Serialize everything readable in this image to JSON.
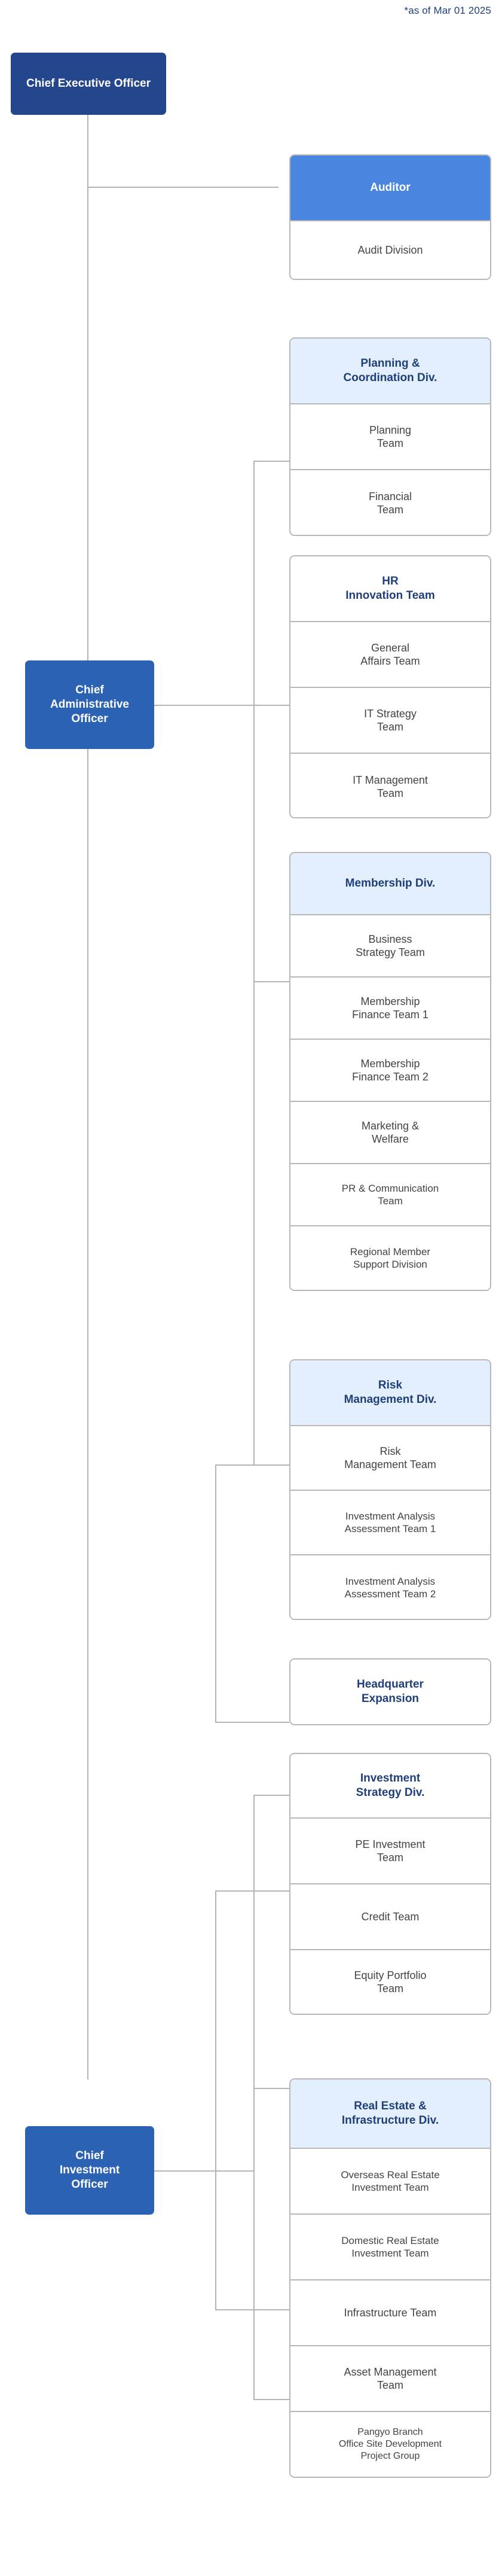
{
  "meta": {
    "date_note": "*as of Mar 01 2025",
    "colors": {
      "ceo_fill": "#23468c",
      "cxo_fill": "#2b62b3",
      "auditor_header_fill": "#4a86e0",
      "division_header_fill": "#e3effc",
      "division_header_text": "#1f3f7a",
      "team_text": "#434343",
      "border": "#b8b8b8",
      "connector": "#b4b4b4"
    }
  },
  "executives": {
    "ceo": "Chief Executive Officer",
    "cao": "Chief\nAdministrative\nOfficer",
    "cao_line1": "Chief",
    "cao_line2": "Administrative",
    "cao_line3": "Officer",
    "cio_line1": "Chief",
    "cio_line2": "Investment",
    "cio_line3": "Officer"
  },
  "groups": [
    {
      "id": "auditor",
      "header": {
        "label": "Auditor",
        "style": "solid-blue"
      },
      "items": [
        "Audit Division"
      ]
    },
    {
      "id": "planning-coordination",
      "header": {
        "label": "Planning &\nCoordination Div.",
        "style": "light-blue"
      },
      "header_line1": "Planning &",
      "header_line2": "Coordination Div.",
      "items": [
        "Planning\nTeam",
        "Financial\nTeam"
      ]
    },
    {
      "id": "hr-innovation",
      "header": {
        "label": "HR\nInnovation Team",
        "style": "white-blue"
      },
      "header_line1": "HR",
      "header_line2": "Innovation Team",
      "items": [
        "General\nAffairs Team",
        "IT Strategy\nTeam",
        "IT Management\nTeam"
      ]
    },
    {
      "id": "membership",
      "header": {
        "label": "Membership Div.",
        "style": "light-blue"
      },
      "items": [
        "Business\nStrategy Team",
        "Membership\nFinance Team 1",
        "Membership\nFinance Team 2",
        "Marketing &\nWelfare",
        "PR & Communication\nTeam",
        "Regional Member\nSupport Division"
      ]
    },
    {
      "id": "risk-management",
      "header": {
        "label": "Risk\nManagement Div.",
        "style": "light-blue"
      },
      "header_line1": "Risk",
      "header_line2": "Management Div.",
      "items": [
        "Risk\nManagement Team",
        "Investment Analysis\nAssessment Team 1",
        "Investment Analysis\nAssessment Team 2"
      ]
    },
    {
      "id": "headquarter-expansion",
      "header": {
        "label": "Headquarter\nExpansion",
        "style": "white-blue"
      },
      "header_line1": "Headquarter",
      "header_line2": "Expansion",
      "items": []
    },
    {
      "id": "investment-strategy",
      "header": {
        "label": "Investment\nStrategy Div.",
        "style": "white-blue"
      },
      "header_line1": "Investment",
      "header_line2": "Strategy Div.",
      "items": [
        "PE Investment\nTeam",
        "Credit Team",
        "Equity Portfolio\nTeam"
      ]
    },
    {
      "id": "real-estate-infrastructure",
      "header": {
        "label": "Real Estate &\nInfrastructure Div.",
        "style": "light-blue"
      },
      "header_line1": "Real Estate &",
      "header_line2": "Infrastructure Div.",
      "items": [
        "Overseas Real Estate\nInvestment Team",
        "Domestic Real Estate\nInvestment Team",
        "Infrastructure Team",
        "Asset Management\nTeam",
        "Pangyo Branch\nOffice Site Development\nProject Group"
      ]
    }
  ],
  "labels": {
    "audit_division": "Audit Division",
    "auditor": "Auditor",
    "planning_team": "Planning\nTeam",
    "planning_team_l1": "Planning",
    "planning_team_l2": "Team",
    "financial_team_l1": "Financial",
    "financial_team_l2": "Team",
    "general_affairs_l1": "General",
    "general_affairs_l2": "Affairs Team",
    "it_strategy_l1": "IT Strategy",
    "it_strategy_l2": "Team",
    "it_management_l1": "IT Management",
    "it_management_l2": "Team",
    "membership_div": "Membership Div.",
    "business_strategy_l1": "Business",
    "business_strategy_l2": "Strategy Team",
    "mem_fin1_l1": "Membership",
    "mem_fin1_l2": "Finance Team 1",
    "mem_fin2_l1": "Membership",
    "mem_fin2_l2": "Finance Team 2",
    "marketing_l1": "Marketing &",
    "marketing_l2": "Welfare",
    "pr_l1": "PR & Communication",
    "pr_l2": "Team",
    "regional_l1": "Regional Member",
    "regional_l2": "Support Division",
    "risk_team_l1": "Risk",
    "risk_team_l2": "Management Team",
    "ia1_l1": "Investment Analysis",
    "ia1_l2": "Assessment Team 1",
    "ia2_l1": "Investment Analysis",
    "ia2_l2": "Assessment Team 2",
    "pe_l1": "PE Investment",
    "pe_l2": "Team",
    "credit_team": "Credit Team",
    "equity_l1": "Equity Portfolio",
    "equity_l2": "Team",
    "overseas_l1": "Overseas Real Estate",
    "overseas_l2": "Investment Team",
    "domestic_l1": "Domestic Real Estate",
    "domestic_l2": "Investment Team",
    "infrastructure_team": "Infrastructure Team",
    "asset_l1": "Asset Management",
    "asset_l2": "Team",
    "pangyo_l1": "Pangyo Branch",
    "pangyo_l2": "Office Site Development",
    "pangyo_l3": "Project Group"
  }
}
